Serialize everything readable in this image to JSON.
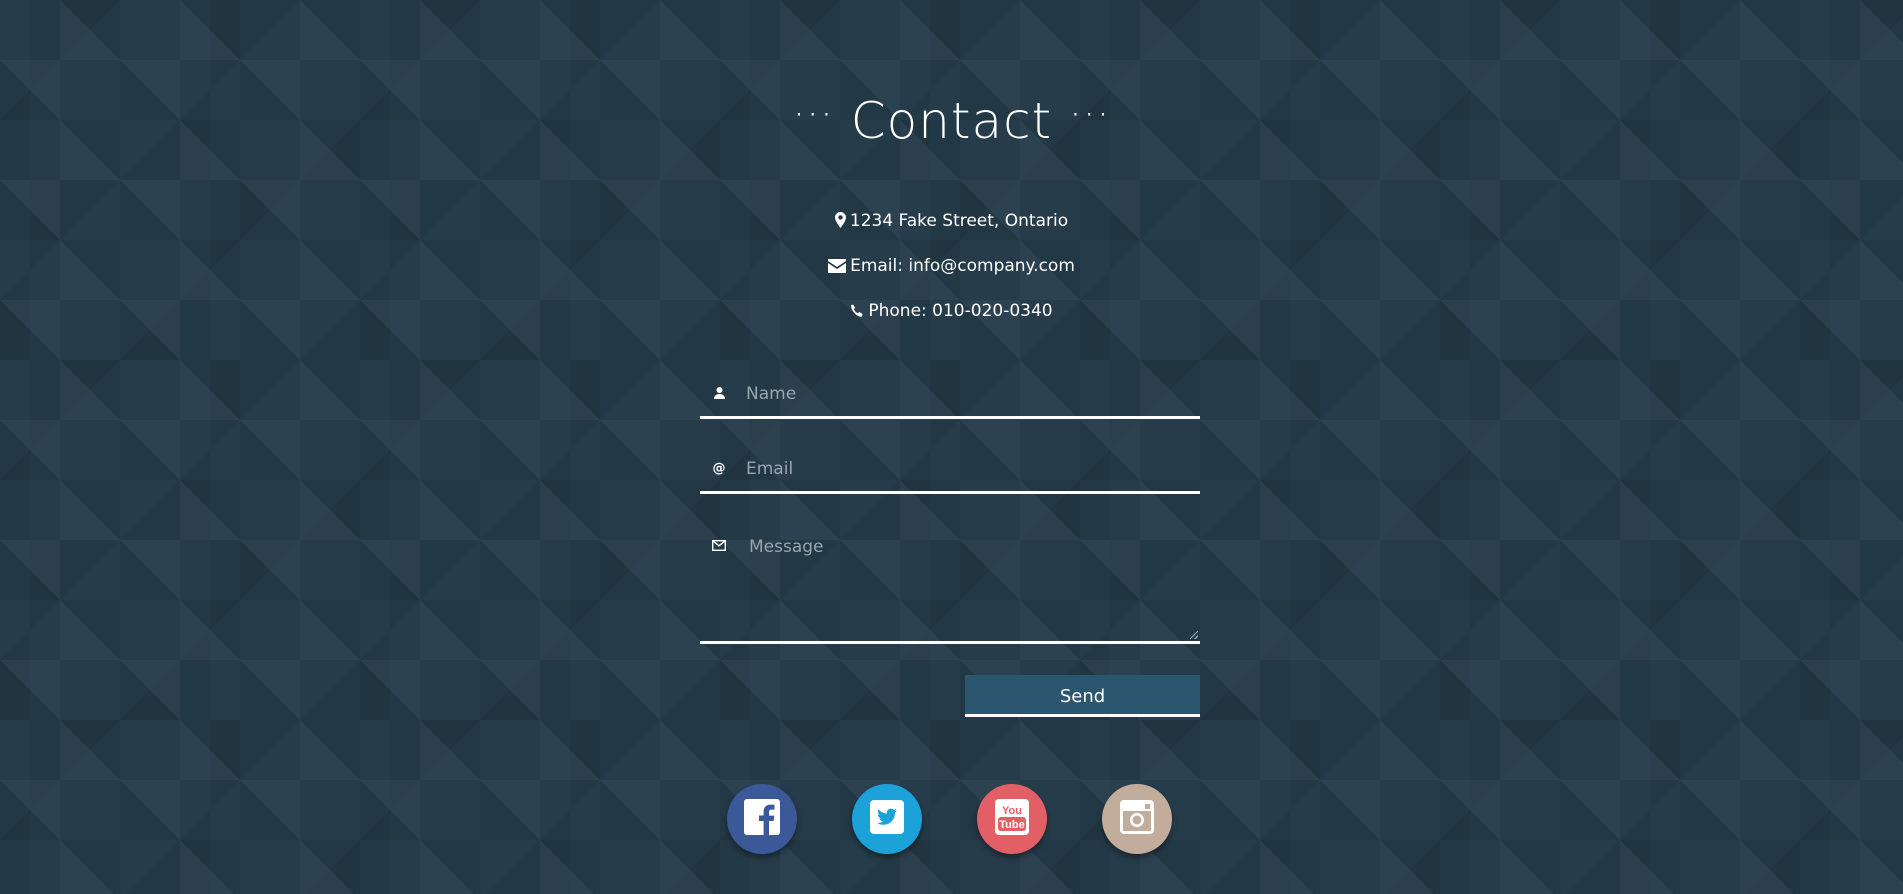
{
  "heading": {
    "dots_left": "···",
    "title": "Contact",
    "dots_right": "···"
  },
  "contact_info": {
    "address": "1234 Fake Street, Ontario",
    "email": "Email: info@company.com",
    "phone": "Phone: 010-020-0340"
  },
  "form": {
    "name_placeholder": "Name",
    "email_placeholder": "Email",
    "message_placeholder": "Message",
    "email_symbol": "@",
    "send_label": "Send"
  },
  "social": [
    {
      "name": "facebook",
      "color": "#3b5998"
    },
    {
      "name": "twitter",
      "color": "#1da1d9"
    },
    {
      "name": "youtube",
      "color": "#e35f66"
    },
    {
      "name": "instagram",
      "color": "#c2ad9c"
    }
  ],
  "colors": {
    "background": "#263c4a",
    "button": "#2c5670",
    "accent": "#ffffff"
  }
}
